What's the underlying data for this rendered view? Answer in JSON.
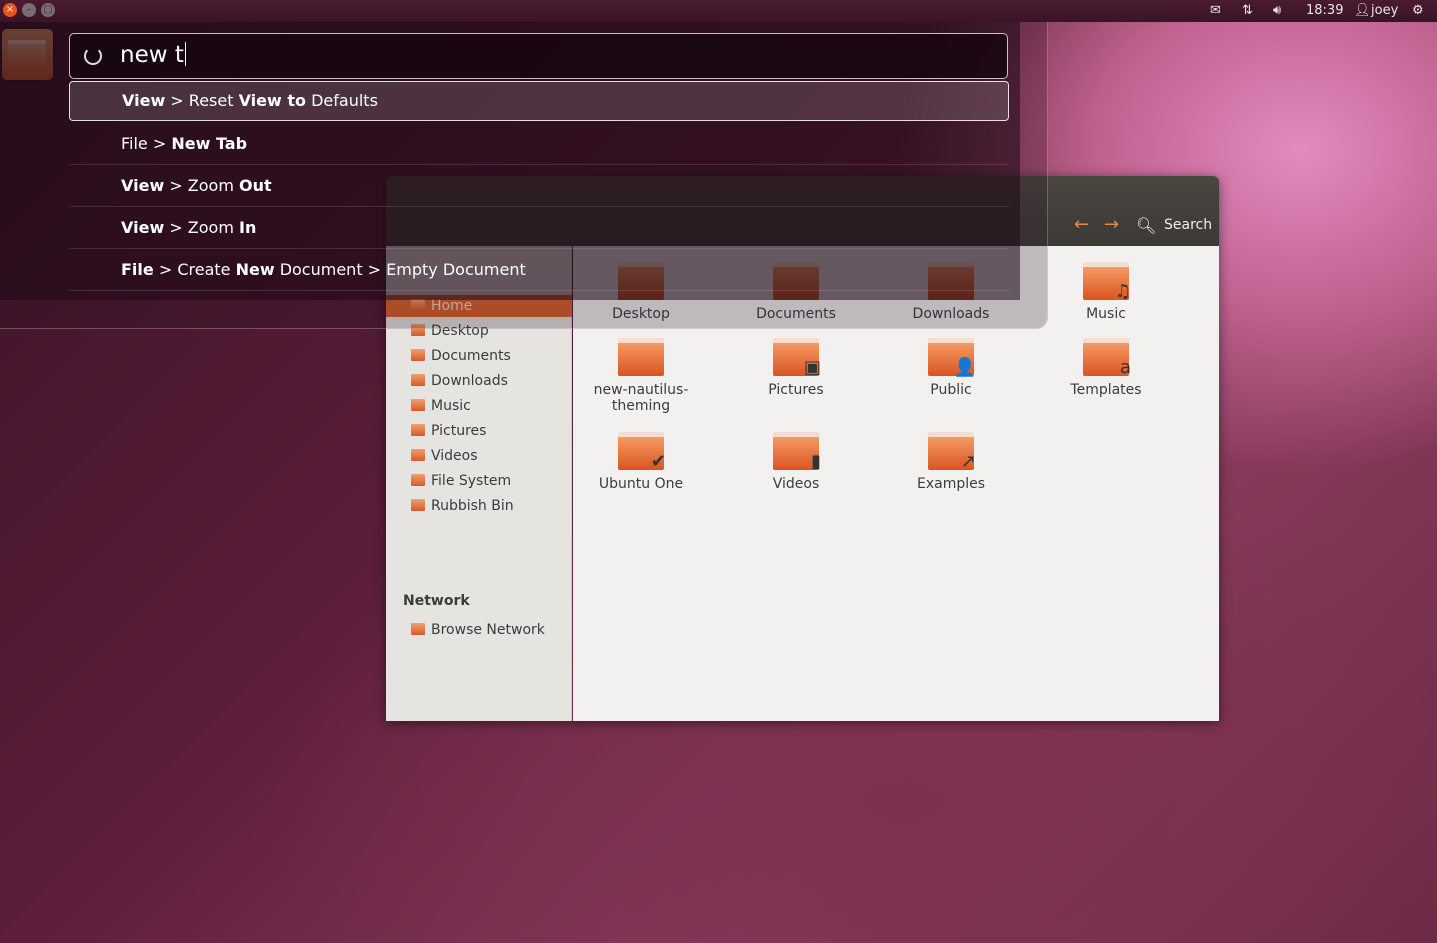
{
  "panel": {
    "close": "×",
    "minimize": "–",
    "maximize": "□",
    "time": "18:39",
    "user": "joey",
    "icons": [
      "mail-icon",
      "network-icon",
      "volume-icon",
      "user-icon",
      "power-gear-icon"
    ]
  },
  "hud": {
    "query": "new t",
    "results": [
      [
        {
          "t": "View",
          "b": true
        },
        {
          "t": " > Reset "
        },
        {
          "t": "View to",
          "b": true
        },
        {
          "t": " Defaults"
        }
      ],
      [
        {
          "t": "File"
        },
        {
          "t": " > "
        },
        {
          "t": "New Tab",
          "b": true
        }
      ],
      [
        {
          "t": "View",
          "b": true
        },
        {
          "t": " > Zoom "
        },
        {
          "t": "Out",
          "b": true
        }
      ],
      [
        {
          "t": "View",
          "b": true
        },
        {
          "t": " > Zoom "
        },
        {
          "t": "In",
          "b": true
        }
      ],
      [
        {
          "t": "File",
          "b": true
        },
        {
          "t": " > Create "
        },
        {
          "t": "New",
          "b": true
        },
        {
          "t": " Document > Empty Document"
        }
      ]
    ]
  },
  "nautilus": {
    "search_label": "Search",
    "sidebar": [
      "Home",
      "Desktop",
      "Documents",
      "Downloads",
      "Music",
      "Pictures",
      "Videos",
      "File System",
      "Rubbish Bin"
    ],
    "network_heading": "Network",
    "network_items": [
      "Browse Network"
    ],
    "files": [
      {
        "name": "Desktop"
      },
      {
        "name": "Documents"
      },
      {
        "name": "Downloads"
      },
      {
        "name": "Music",
        "emblem": "♫"
      },
      {
        "name": "new-nautilus-theming"
      },
      {
        "name": "Pictures",
        "emblem": "▣"
      },
      {
        "name": "Public",
        "emblem": "👤"
      },
      {
        "name": "Templates",
        "emblem": "a"
      },
      {
        "name": "Ubuntu One",
        "emblem": "✔"
      },
      {
        "name": "Videos",
        "emblem": "▮"
      },
      {
        "name": "Examples",
        "emblem": "↗"
      }
    ]
  },
  "colors": {
    "accent": "#dd4814",
    "selection": "#d9622b"
  }
}
